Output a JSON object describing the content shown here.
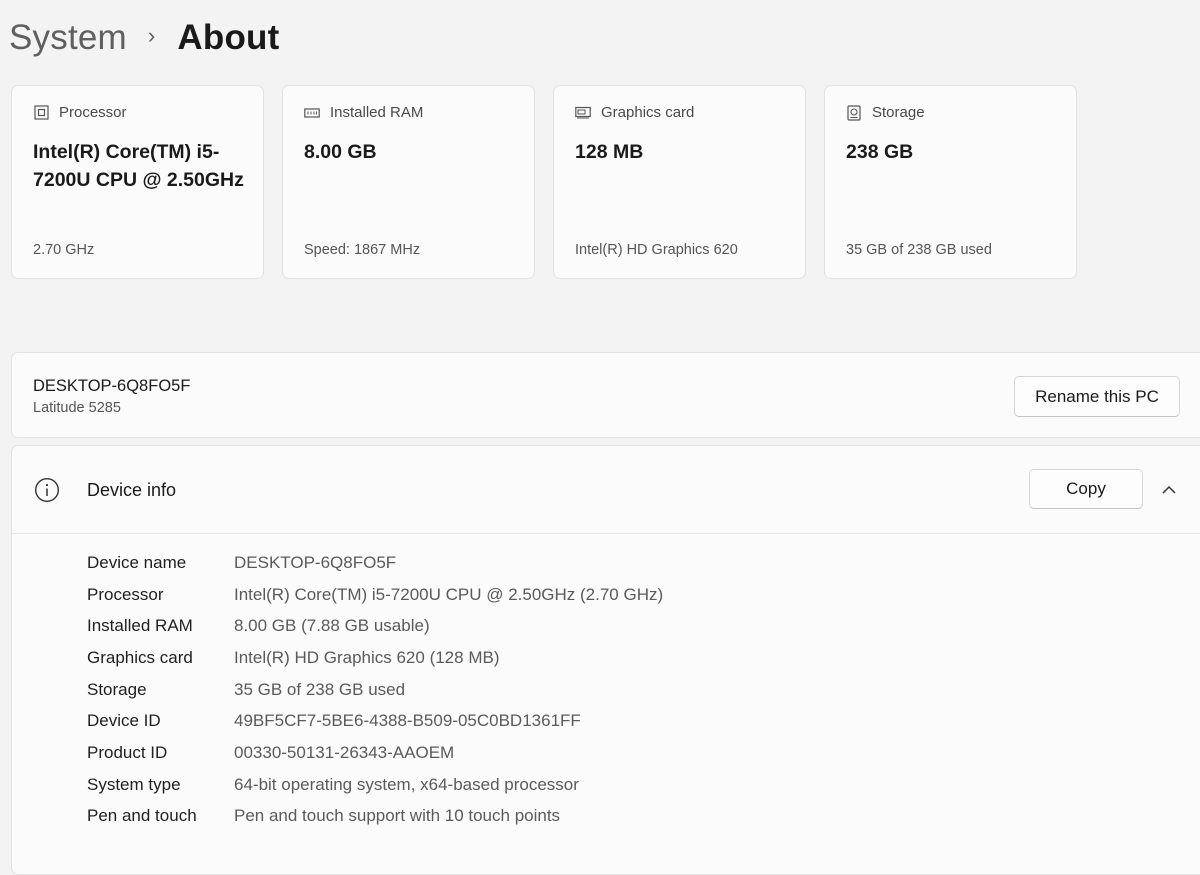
{
  "breadcrumb": {
    "parent": "System",
    "separator": "›",
    "current": "About"
  },
  "cards": [
    {
      "icon": "processor-icon",
      "label": "Processor",
      "value": "Intel(R) Core(TM) i5-7200U CPU @ 2.50GHz",
      "sub": "2.70 GHz"
    },
    {
      "icon": "ram-icon",
      "label": "Installed RAM",
      "value": "8.00 GB",
      "sub": "Speed: 1867 MHz"
    },
    {
      "icon": "graphics-card-icon",
      "label": "Graphics card",
      "value": "128 MB",
      "sub": "Intel(R) HD Graphics 620"
    },
    {
      "icon": "storage-icon",
      "label": "Storage",
      "value": "238 GB",
      "sub": "35 GB of 238 GB used"
    }
  ],
  "pc": {
    "name": "DESKTOP-6Q8FO5F",
    "model": "Latitude 5285",
    "rename_label": "Rename this PC"
  },
  "device_info": {
    "title": "Device info",
    "copy_label": "Copy",
    "specs": [
      {
        "label": "Device name",
        "value": "DESKTOP-6Q8FO5F"
      },
      {
        "label": "Processor",
        "value": "Intel(R) Core(TM) i5-7200U CPU @ 2.50GHz (2.70 GHz)"
      },
      {
        "label": "Installed RAM",
        "value": "8.00 GB (7.88 GB usable)"
      },
      {
        "label": "Graphics card",
        "value": "Intel(R) HD Graphics 620 (128 MB)"
      },
      {
        "label": "Storage",
        "value": "35 GB of 238 GB used"
      },
      {
        "label": "Device ID",
        "value": "49BF5CF7-5BE6-4388-B509-05C0BD1361FF"
      },
      {
        "label": "Product ID",
        "value": "00330-50131-26343-AAOEM"
      },
      {
        "label": "System type",
        "value": "64-bit operating system, x64-based processor"
      },
      {
        "label": "Pen and touch",
        "value": "Pen and touch support with 10 touch points"
      }
    ]
  }
}
